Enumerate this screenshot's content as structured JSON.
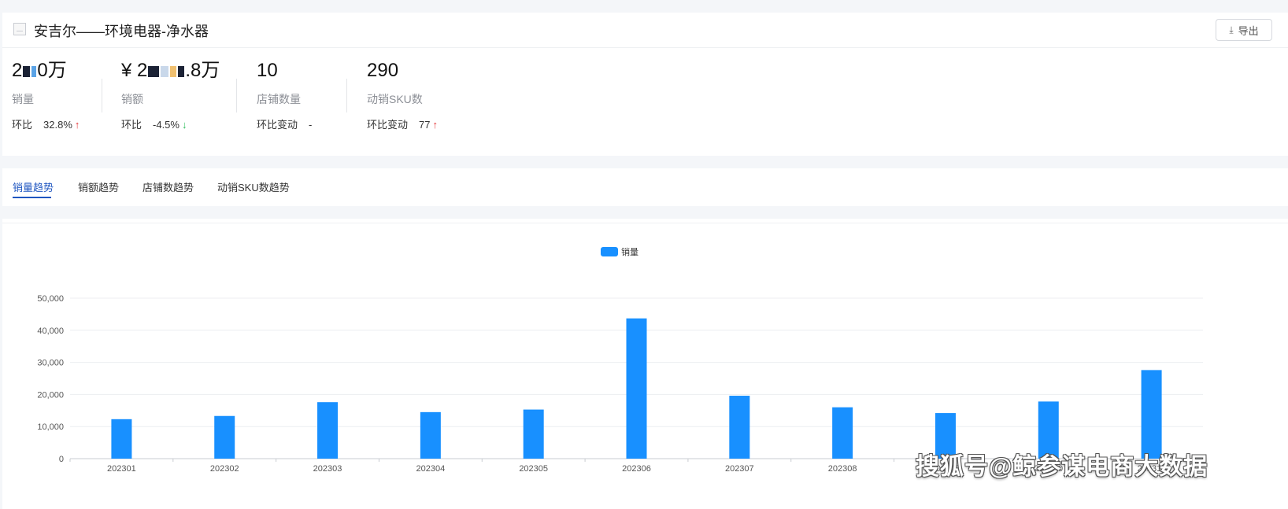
{
  "header": {
    "title": "安吉尔——环境电器-净水器",
    "export_label": "导出"
  },
  "metrics": [
    {
      "value_prefix": "2",
      "value_suffix": "0万",
      "label": "销量",
      "change_label": "环比",
      "change_value": "32.8%",
      "trend": "up"
    },
    {
      "value_prefix": "¥ 2",
      "value_suffix": ".8万",
      "label": "销额",
      "change_label": "环比",
      "change_value": "-4.5%",
      "trend": "down"
    },
    {
      "value_prefix": "10",
      "value_suffix": "",
      "label": "店铺数量",
      "change_label": "环比变动",
      "change_value": "-",
      "trend": "none"
    },
    {
      "value_prefix": "290",
      "value_suffix": "",
      "label": "动销SKU数",
      "change_label": "环比变动",
      "change_value": "77",
      "trend": "up"
    }
  ],
  "tabs": [
    {
      "label": "销量趋势",
      "active": true
    },
    {
      "label": "销额趋势",
      "active": false
    },
    {
      "label": "店铺数趋势",
      "active": false
    },
    {
      "label": "动销SKU数趋势",
      "active": false
    }
  ],
  "chart_data": {
    "type": "bar",
    "categories": [
      "202301",
      "202302",
      "202303",
      "202304",
      "202305",
      "202306",
      "202307",
      "202308",
      "202309",
      "202310",
      "202311"
    ],
    "series": [
      {
        "name": "销量",
        "color": "#1890ff",
        "values": [
          12300,
          13300,
          17600,
          14500,
          15300,
          43700,
          19600,
          16000,
          14200,
          17800,
          27600
        ]
      }
    ],
    "ylim": [
      0,
      50000
    ],
    "yticks": [
      "0",
      "10,000",
      "20,000",
      "30,000",
      "40,000",
      "50,000"
    ],
    "legend_position": "top-center",
    "grid": true
  },
  "watermark": "搜狐号@鲸参谋电商大数据",
  "icons": {
    "thumbnail": "image-placeholder-icon",
    "export": "download-icon",
    "up": "arrow-up-icon",
    "down": "arrow-down-icon"
  }
}
